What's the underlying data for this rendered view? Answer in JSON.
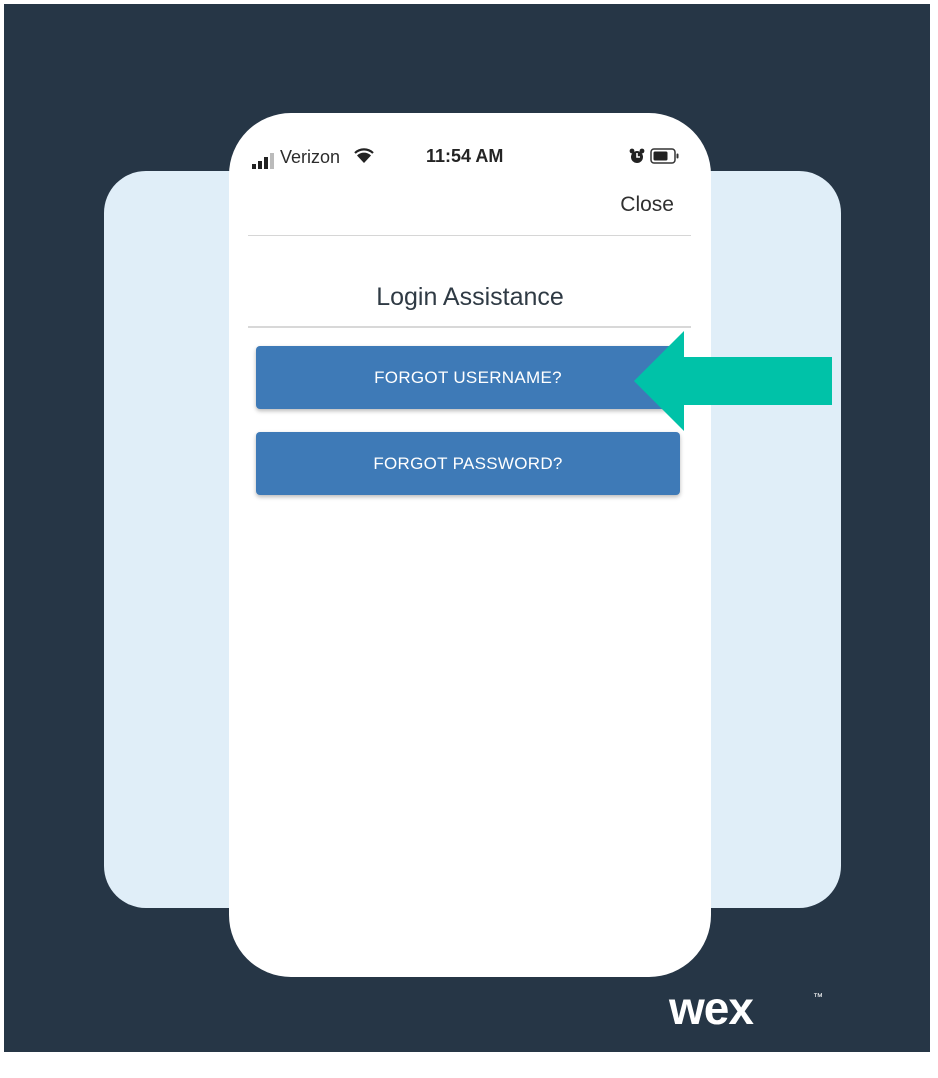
{
  "status_bar": {
    "carrier": "Verizon",
    "time": "11:54 AM",
    "icons": [
      "signal-bars-icon",
      "wifi-icon",
      "alarm-icon",
      "battery-icon"
    ]
  },
  "header": {
    "close_label": "Close"
  },
  "main": {
    "title": "Login Assistance",
    "buttons": {
      "forgot_username": "FORGOT USERNAME?",
      "forgot_password": "FORGOT PASSWORD?"
    }
  },
  "annotation": {
    "icon": "pointer-arrow-icon",
    "color": "#00c2a8"
  },
  "brand": {
    "logo_text": "wex",
    "trademark": "™"
  },
  "colors": {
    "background": "#263646",
    "card": "#e0eef8",
    "button": "#3e7ab7",
    "arrow": "#00c2a8"
  }
}
